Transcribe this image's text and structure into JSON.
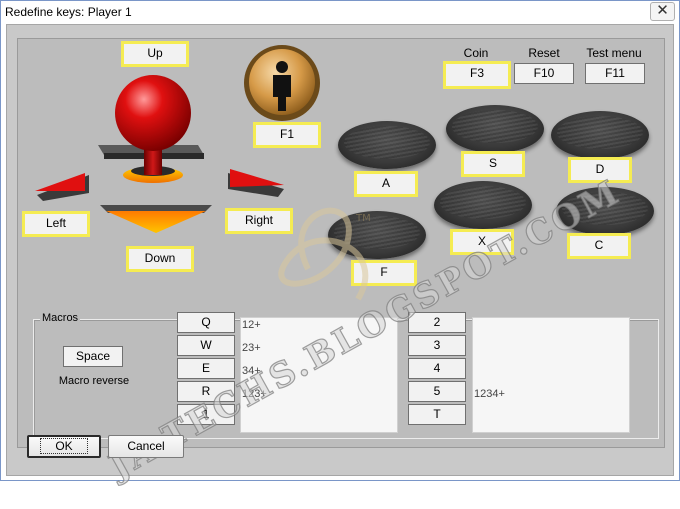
{
  "window": {
    "title": "Redefine keys: Player 1",
    "close_glyph": "✕"
  },
  "joystick": {
    "up": "Up",
    "down": "Down",
    "left": "Left",
    "right": "Right"
  },
  "start_button": {
    "label": "F1"
  },
  "system": {
    "coin": {
      "header": "Coin",
      "key": "F3"
    },
    "reset": {
      "header": "Reset",
      "key": "F10"
    },
    "test_menu": {
      "header": "Test menu",
      "key": "F11"
    }
  },
  "buttons": {
    "a": "A",
    "s": "S",
    "d": "D",
    "x": "X",
    "c": "C",
    "f": "F"
  },
  "macros": {
    "group_label": "Macros",
    "special_key": "Space",
    "reverse_label": "Macro reverse",
    "left_keys": [
      "Q",
      "W",
      "E",
      "R",
      "1"
    ],
    "left_values": [
      "12+",
      "23+",
      "34+",
      "123+"
    ],
    "right_keys": [
      "2",
      "3",
      "4",
      "5",
      "T"
    ],
    "right_value": "1234+"
  },
  "dialog": {
    "ok_label": "OK",
    "cancel_label": "Cancel"
  },
  "watermark": {
    "text": "JA-TECHS.BLOGSPOT.COM",
    "tm": "TM"
  },
  "colors": {
    "highlight": "#f5ec52",
    "ball": "#d40000",
    "arrow": "#e01010",
    "base": "#f28c00"
  }
}
